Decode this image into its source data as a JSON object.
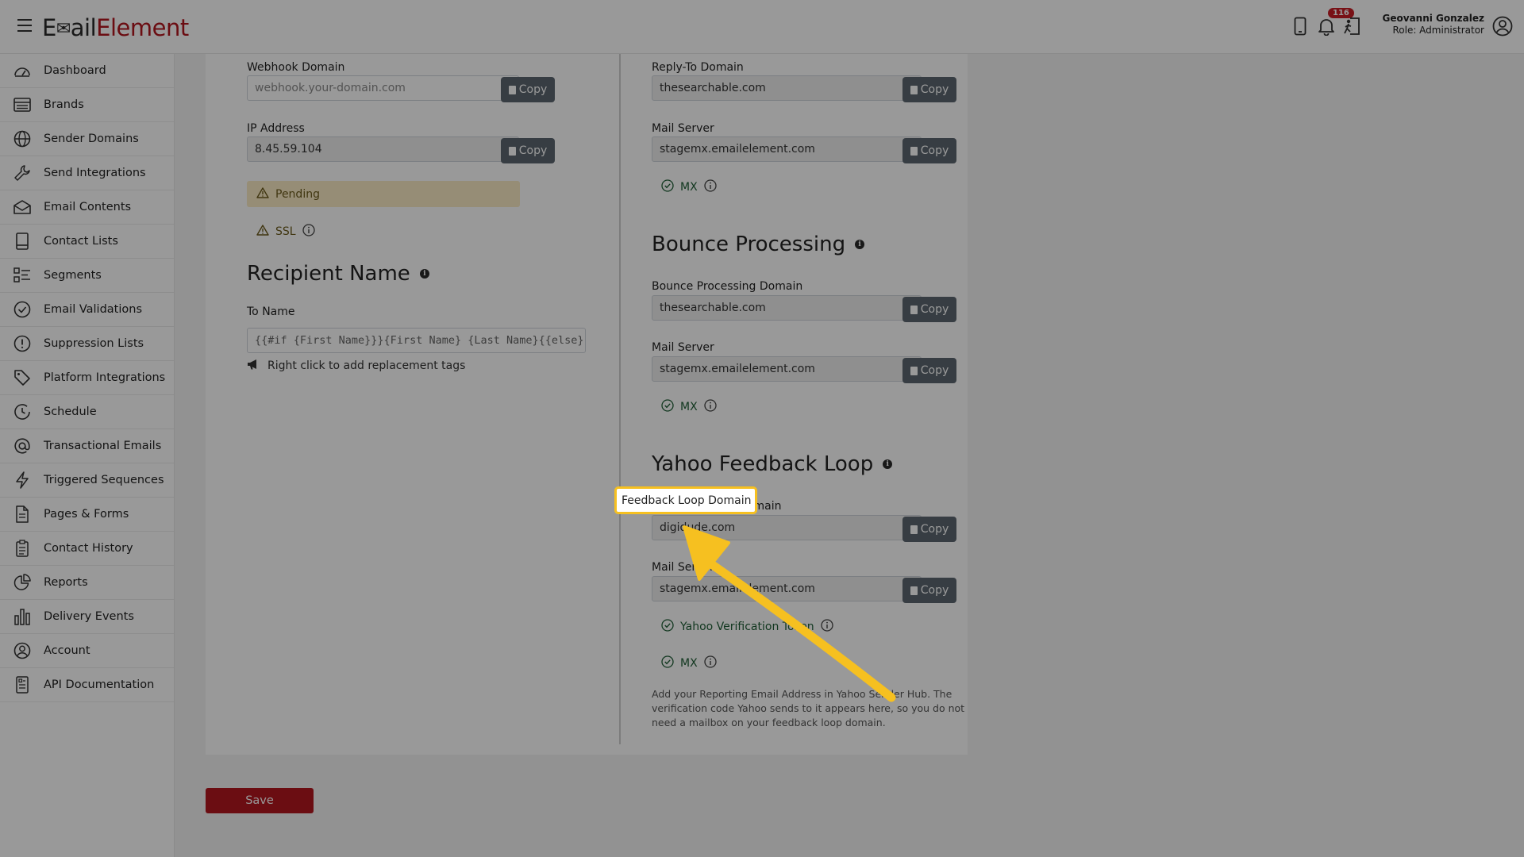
{
  "app": {
    "logo_part1": "E",
    "logo_part2": "ail",
    "logo_part3": "Element",
    "notification_count": "116",
    "user_name": "Geovanni Gonzalez",
    "user_role": "Role: Administrator"
  },
  "colors": {
    "brand_red": "#b3161f",
    "highlight_yellow": "#f6c020",
    "copy_button": "#5c6770"
  },
  "sidebar": {
    "items": [
      {
        "label": "Dashboard",
        "icon": "dashboard-icon"
      },
      {
        "label": "Brands",
        "icon": "brands-icon"
      },
      {
        "label": "Sender Domains",
        "icon": "globe-icon"
      },
      {
        "label": "Send Integrations",
        "icon": "wrench-icon"
      },
      {
        "label": "Email Contents",
        "icon": "envelope-icon"
      },
      {
        "label": "Contact Lists",
        "icon": "book-icon"
      },
      {
        "label": "Segments",
        "icon": "segments-icon"
      },
      {
        "label": "Email Validations",
        "icon": "check-circle-icon"
      },
      {
        "label": "Suppression Lists",
        "icon": "exclamation-circle-icon"
      },
      {
        "label": "Platform Integrations",
        "icon": "tag-icon"
      },
      {
        "label": "Schedule",
        "icon": "clock-icon"
      },
      {
        "label": "Transactional Emails",
        "icon": "at-icon"
      },
      {
        "label": "Triggered Sequences",
        "icon": "lightning-icon"
      },
      {
        "label": "Pages & Forms",
        "icon": "file-icon"
      },
      {
        "label": "Contact History",
        "icon": "clipboard-icon"
      },
      {
        "label": "Reports",
        "icon": "pie-chart-icon"
      },
      {
        "label": "Delivery Events",
        "icon": "bar-chart-icon"
      },
      {
        "label": "Account",
        "icon": "user-circle-icon"
      },
      {
        "label": "API Documentation",
        "icon": "document-icon"
      }
    ]
  },
  "left": {
    "webhook_label": "Webhook Domain",
    "webhook_placeholder": "webhook.your-domain.com",
    "ip_label": "IP Address",
    "ip_value": "8.45.59.104",
    "pending_label": "Pending",
    "ssl_label": "SSL",
    "recipient_heading": "Recipient Name",
    "to_name_label": "To Name",
    "to_name_value": "{{#if {First Name}}}{First Name} {Last Name}{{else}...",
    "replacement_hint": "Right click to add replacement tags"
  },
  "right": {
    "reply_to_label": "Reply-To Domain",
    "reply_to_value": "thesearchable.com",
    "mail_server_label": "Mail Server",
    "mail_server_value": "stagemx.emailelement.com",
    "mx_label": "MX",
    "bounce_heading": "Bounce Processing",
    "bounce_domain_label": "Bounce Processing Domain",
    "bounce_domain_value": "thesearchable.com",
    "yahoo_heading": "Yahoo Feedback Loop",
    "feedback_domain_label": "Feedback Loop Domain",
    "feedback_domain_value": "digidude.com",
    "yahoo_token_label": "Yahoo Verification Token",
    "note": "Add your Reporting Email Address in Yahoo Sender Hub. The verification code Yahoo sends to it appears here, so you do not need a mailbox on your feedback loop domain."
  },
  "buttons": {
    "copy": "Copy",
    "save": "Save"
  }
}
